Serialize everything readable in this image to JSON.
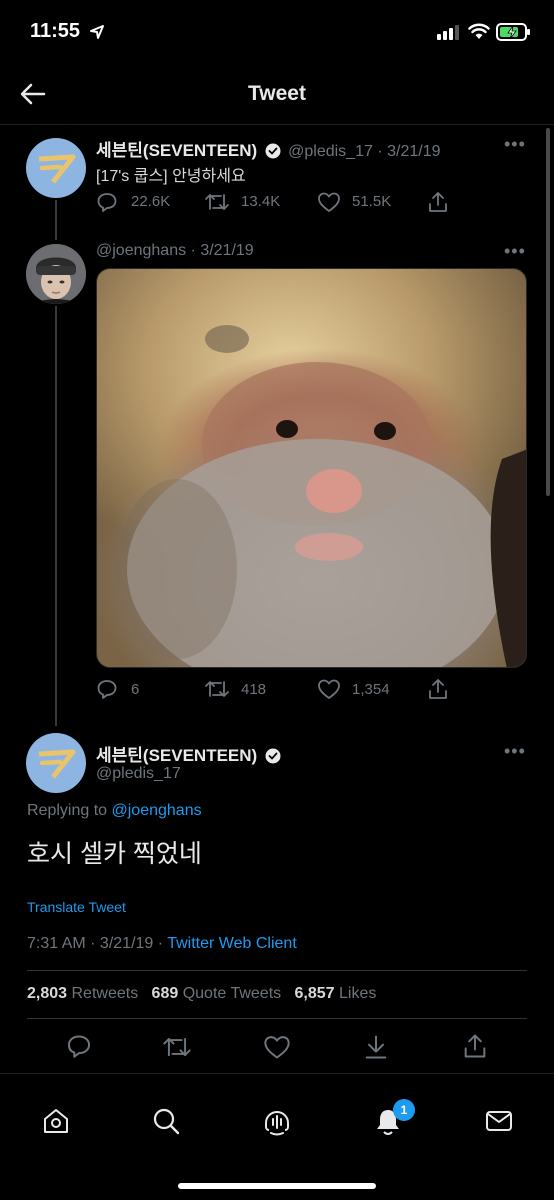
{
  "status_bar": {
    "time": "11:55"
  },
  "header": {
    "title": "Tweet"
  },
  "tweet1": {
    "author_name": "세븐틴(SEVENTEEN)",
    "handle": "@pledis_17",
    "date": "· 3/21/19",
    "text": "[17's 쿱스] 안녕하세요",
    "replies": "22.6K",
    "retweets": "13.4K",
    "likes": "51.5K"
  },
  "tweet2": {
    "handle": "@joenghans",
    "date": "· 3/21/19",
    "replies": "6",
    "retweets": "418",
    "likes": "1,354"
  },
  "main_tweet": {
    "author_name": "세븐틴(SEVENTEEN)",
    "handle": "@pledis_17",
    "replying_prefix": "Replying to ",
    "replying_to": "@joenghans",
    "text": "호시 셀카 찍었네",
    "translate": "Translate Tweet",
    "timestamp": "7:31 AM · 3/21/19 · ",
    "client": "Twitter Web Client",
    "retweets_count": "2,803",
    "retweets_label": "Retweets",
    "quotes_count": "689",
    "quotes_label": "Quote Tweets",
    "likes_count": "6,857",
    "likes_label": "Likes"
  },
  "tab_bar": {
    "notification_badge": "1"
  },
  "colors": {
    "accent": "#1d9bf0",
    "logo_bg": "#8eb5e2",
    "logo_fg": "#e9c46a"
  },
  "icons": [
    "back-arrow-icon",
    "verified-icon",
    "reply-icon",
    "retweet-icon",
    "like-icon",
    "share-icon",
    "home-icon",
    "search-icon",
    "spaces-icon",
    "notifications-icon",
    "messages-icon"
  ]
}
